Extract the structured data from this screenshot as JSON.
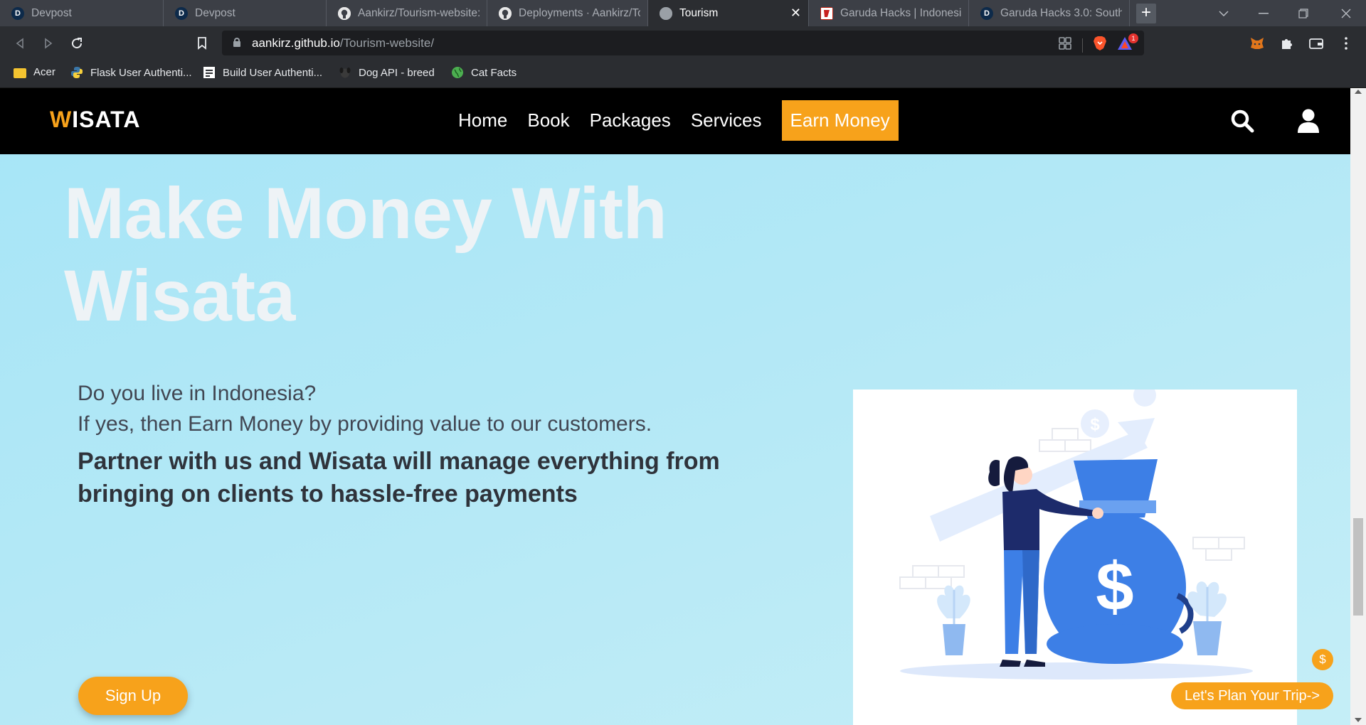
{
  "browser": {
    "tabs": [
      {
        "title": "Devpost",
        "favicon": "devpost-d"
      },
      {
        "title": "Devpost",
        "favicon": "devpost-d"
      },
      {
        "title": "Aankirz/Tourism-website: a",
        "favicon": "github-icon"
      },
      {
        "title": "Deployments · Aankirz/Tou",
        "favicon": "github-icon"
      },
      {
        "title": "Tourism",
        "favicon": "globe-icon",
        "active": true
      },
      {
        "title": "Garuda Hacks | Indonesia's",
        "favicon": "garuda-icon"
      },
      {
        "title": "Garuda Hacks 3.0: Southea",
        "favicon": "devpost-d"
      }
    ],
    "tab_close_glyph": "✕",
    "new_tab_glyph": "+",
    "url_host": "aankirz.github.io",
    "url_path": "/Tourism-website/",
    "brave_badge_count": "1",
    "bookmarks": [
      {
        "label": "Acer",
        "icon": "folder-icon"
      },
      {
        "label": "Flask User Authenti...",
        "icon": "python-icon"
      },
      {
        "label": "Build User Authenti...",
        "icon": "doc-icon"
      },
      {
        "label": "Dog API - breed",
        "icon": "dog-icon"
      },
      {
        "label": "Cat Facts",
        "icon": "globe-green-icon"
      }
    ]
  },
  "site": {
    "logo_first": "W",
    "logo_rest": "ISATA",
    "nav": {
      "home": "Home",
      "book": "Book",
      "packages": "Packages",
      "services": "Services",
      "earn": "Earn Money"
    },
    "hero": {
      "title_line1": "Make Money With",
      "title_line2": "Wisata",
      "question_line1": "Do you live in Indonesia?",
      "question_line2": "If yes, then Earn Money by providing value to our customers.",
      "partner_line1": "Partner with us and Wisata will manage everything from",
      "partner_line2": "bringing on clients to hassle-free payments"
    },
    "signup_label": "Sign Up",
    "dollar_badge": "$",
    "plan_label": "Let's Plan Your Trip->",
    "illustration_symbol": "$",
    "accent_color": "#f7a21b",
    "background_color": "#b3e8f6"
  }
}
